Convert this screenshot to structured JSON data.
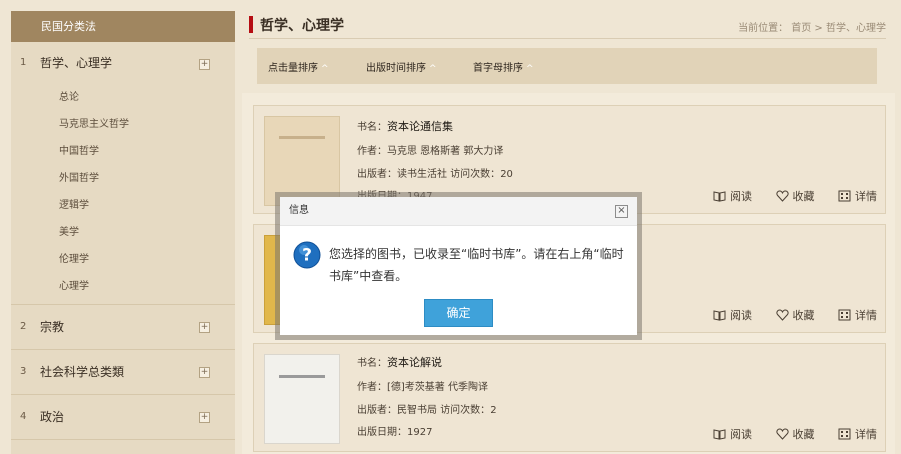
{
  "sidebar": {
    "header": "民国分类法",
    "categories": [
      {
        "num": "1",
        "name": "哲学、心理学"
      },
      {
        "num": "2",
        "name": "宗教"
      },
      {
        "num": "3",
        "name": "社会科学总类類"
      },
      {
        "num": "4",
        "name": "政治"
      }
    ],
    "subitems": [
      "总论",
      "马克思主义哲学",
      "中国哲学",
      "外国哲学",
      "逻辑学",
      "美学",
      "伦理学",
      "心理学"
    ],
    "expand_glyph": "+"
  },
  "main": {
    "title": "哲学、心理学",
    "breadcrumb": "当前位置：  首页 > 哲学、心理学",
    "sort": [
      {
        "label": "点击量排序"
      },
      {
        "label": "出版时间排序"
      },
      {
        "label": "首字母排序"
      }
    ],
    "sort_caret": "^"
  },
  "labels": {
    "bookname": "书名：",
    "author": "作者：",
    "publisher": "出版者：",
    "visits": "访问次数：",
    "date": "出版日期：",
    "read": "阅读",
    "favorite": "收藏",
    "detail": "详情"
  },
  "books": [
    {
      "name": "资本论通信集",
      "author": "马克思 恩格斯著 郭大力译",
      "publisher": "读书生活社",
      "visits": "20",
      "date": "1947"
    },
    {
      "name": "",
      "author": "",
      "publisher": "",
      "visits": "",
      "date": ""
    },
    {
      "name": "资本论解说",
      "author": "[德]考茨基著 代季陶译",
      "publisher": "民智书局",
      "visits": "2",
      "date": "1927"
    }
  ],
  "dialog": {
    "title": "信息",
    "close": "×",
    "message": "您选择的图书，已收录至“临时书库”。请在右上角“临时书库”中查看。",
    "ok": "确定"
  },
  "colors": {
    "accent_red": "#b50d12",
    "sidebar_header": "#a08660",
    "button_blue": "#3fa2da"
  }
}
